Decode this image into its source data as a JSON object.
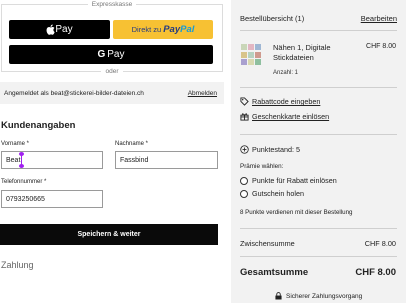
{
  "express": {
    "label": "Expresskasse",
    "apple_pay": "Pay",
    "paypal_prefix": "Direkt zu",
    "paypal_pay": "Pay",
    "paypal_pal": "Pal",
    "google_pay": "Pay",
    "or_label": "oder"
  },
  "login": {
    "text": "Angemeldet als beat@stickerei-bilder-dateien.ch",
    "logout": "Abmelden"
  },
  "customer": {
    "heading": "Kundenangaben",
    "firstname_label": "Vorname *",
    "firstname_value": "Beat",
    "lastname_label": "Nachname *",
    "lastname_value": "Fassbind",
    "phone_label": "Telefonnummer *",
    "phone_value": "0793250665",
    "save_button": "Speichern & weiter"
  },
  "payment": {
    "heading": "Zahlung"
  },
  "summary": {
    "title": "Bestellübersicht (1)",
    "edit": "Bearbeiten",
    "item_name": "Nähen 1, Digitale Stickdateien",
    "item_qty": "Anzahl: 1",
    "item_price": "CHF 8.00",
    "coupon": "Rabattcode eingeben",
    "giftcard": "Geschenkkarte einlösen",
    "points_balance": "Punktestand: 5",
    "choose": "Prämie wählen:",
    "option_points": "Punkte für Rabatt einlösen",
    "option_gift": "Gutschein holen",
    "earn_text": "8 Punkte verdienen mit dieser Bestellung",
    "subtotal_label": "Zwischensumme",
    "subtotal_value": "CHF 8.00",
    "total_label": "Gesamtsumme",
    "total_value": "CHF 8.00",
    "secure": "Sicherer Zahlungsvorgang"
  },
  "colors": {
    "paypal_yellow": "#f7c133",
    "panel_gray": "#f2f2f2",
    "cursor": "#a020f0"
  }
}
